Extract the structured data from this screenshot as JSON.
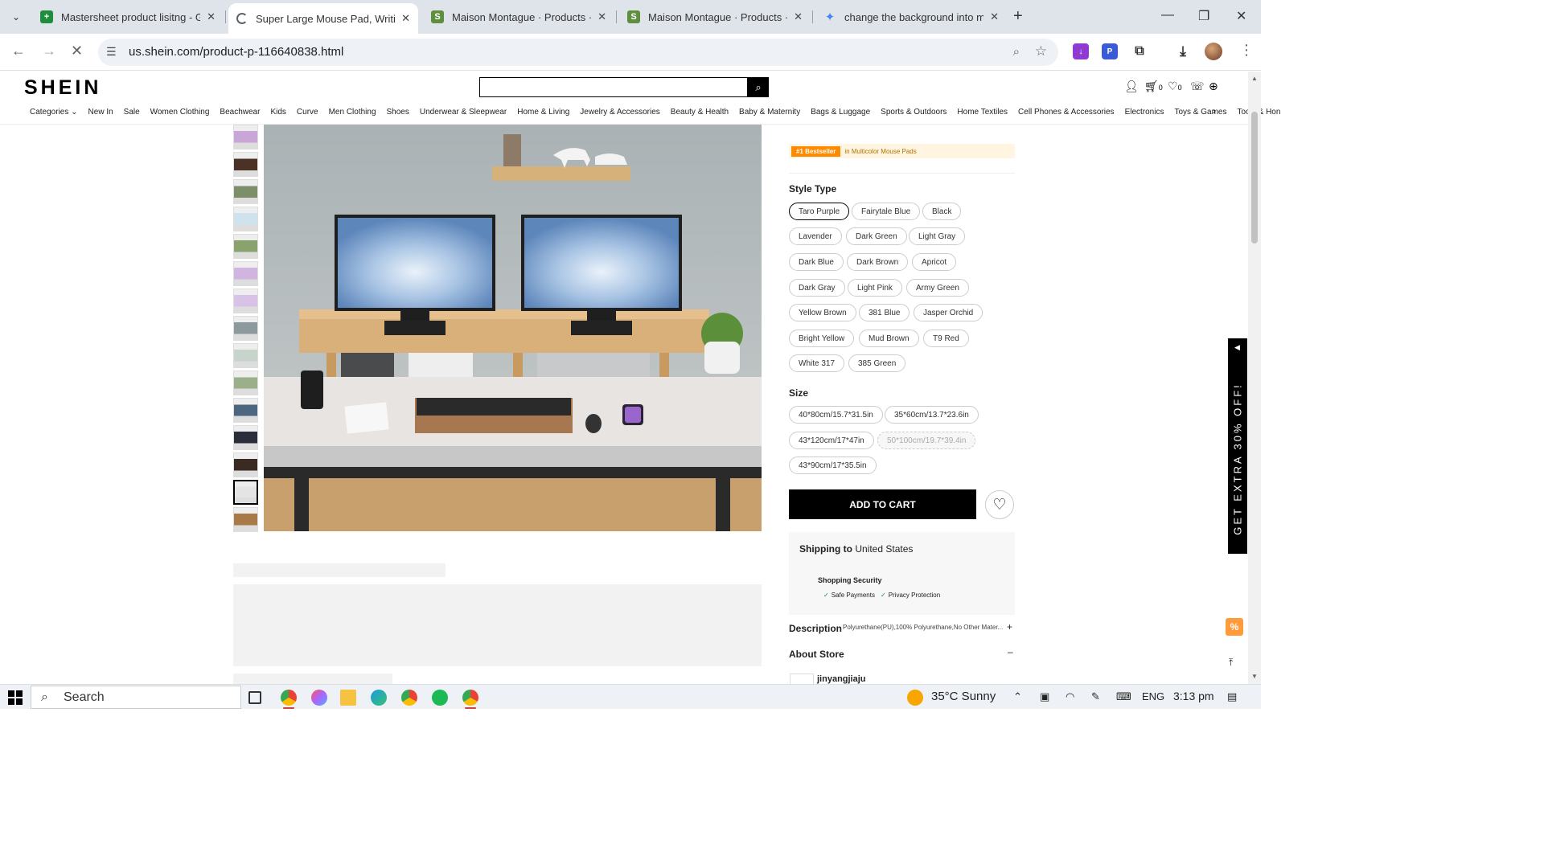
{
  "browser": {
    "tabs": [
      {
        "title": "Mastersheet product lisitng - G",
        "icon": "sheets-icon",
        "color": "#1e8e3e"
      },
      {
        "title": "Super Large Mouse Pad, Writing",
        "icon": "loading-icon",
        "color": "#5f6368"
      },
      {
        "title": "Maison Montague · Products · M",
        "icon": "shopify-icon",
        "color": "#5e8e3e"
      },
      {
        "title": "Maison Montague · Products · A",
        "icon": "shopify-icon",
        "color": "#5e8e3e"
      },
      {
        "title": "change the background into m",
        "icon": "gemini-icon",
        "color": "#4285f4"
      }
    ],
    "url": "us.shein.com/product-p-116640838.html"
  },
  "shein": {
    "logo": "SHEIN",
    "categories": [
      "Categories ⌄",
      "New In",
      "Sale",
      "Women Clothing",
      "Beachwear",
      "Kids",
      "Curve",
      "Men Clothing",
      "Shoes",
      "Underwear & Sleepwear",
      "Home & Living",
      "Jewelry & Accessories",
      "Beauty & Health",
      "Baby & Maternity",
      "Bags & Luggage",
      "Sports & Outdoors",
      "Home Textiles",
      "Cell Phones & Accessories",
      "Electronics",
      "Toys & Games",
      "Tools & Hon"
    ],
    "cart_count": "0",
    "wish_count": "0"
  },
  "product": {
    "bestseller_badge": "#1 Bestseller",
    "bestseller_category": "in Multicolor Mouse Pads",
    "style_label": "Style Type",
    "styles": [
      "Taro Purple",
      "Fairytale Blue",
      "Black",
      "Lavender",
      "Dark Green",
      "Light Gray",
      "Dark Blue",
      "Dark Brown",
      "Apricot",
      "Dark Gray",
      "Light Pink",
      "Army Green",
      "Yellow Brown",
      "381 Blue",
      "Jasper Orchid",
      "Bright Yellow",
      "Mud Brown",
      "T9 Red",
      "White 317",
      "385 Green"
    ],
    "selected_style": "Taro Purple",
    "size_label": "Size",
    "sizes": [
      "40*80cm/15.7*31.5in",
      "35*60cm/13.7*23.6in",
      "43*120cm/17*47in",
      "50*100cm/19.7*39.4in",
      "43*90cm/17*35.5in"
    ],
    "unavailable_size": "50*100cm/19.7*39.4in",
    "add_to_cart": "ADD TO CART",
    "shipping_label": "Shipping to",
    "shipping_dest": "United States",
    "security_title": "Shopping Security",
    "security_items": [
      "Safe Payments",
      "Privacy Protection"
    ],
    "description_label": "Description",
    "description_text": "Polyurethane(PU),100% Polyurethane,No Other Mater...",
    "about_store_label": "About Store",
    "store_name": "jinyangjiaju"
  },
  "promo": {
    "side_text": "GET EXTRA 30% OFF!"
  },
  "taskbar": {
    "search_placeholder": "Search",
    "weather": "35°C  Sunny",
    "language": "ENG",
    "time": "3:13 pm"
  }
}
